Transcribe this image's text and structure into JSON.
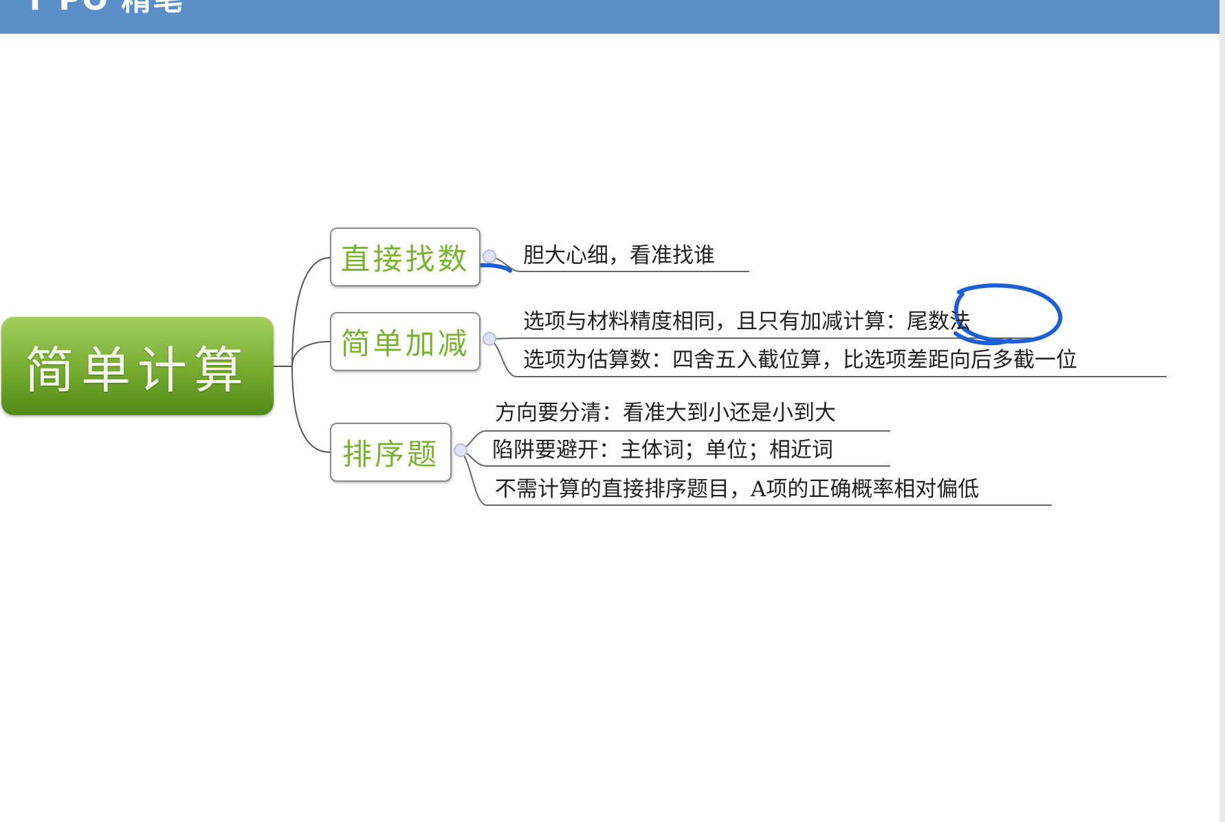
{
  "header": {
    "title": "T PO 精笔"
  },
  "mindmap": {
    "root": "简单计算",
    "branches": [
      {
        "label": "直接找数",
        "items": [
          "胆大心细，看准找谁"
        ]
      },
      {
        "label": "简单加减",
        "items": [
          "选项与材料精度相同，且只有加减计算：尾数法",
          "选项为估算数：四舍五入截位算，比选项差距向后多截一位"
        ]
      },
      {
        "label": "排序题",
        "items": [
          "方向要分清：看准大到小还是小到大",
          "陷阱要避开：主体词；单位；相近词",
          "不需计算的直接排序题目，A项的正确概率相对偏低"
        ]
      }
    ]
  },
  "colors": {
    "header": "#5b8fc9",
    "root_green": "#77ab2f",
    "branch_text": "#7bb135",
    "annotation_ink": "#1f5fd6"
  }
}
